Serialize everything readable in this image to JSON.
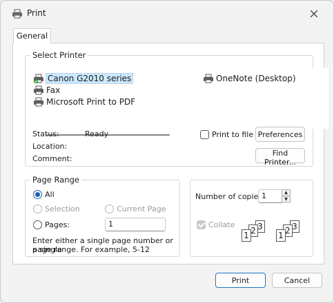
{
  "window": {
    "title": "Print",
    "icons": {
      "title": "printer-icon",
      "close": "close-icon"
    }
  },
  "tabs": [
    {
      "label": "General"
    }
  ],
  "select_printer": {
    "legend": "Select Printer",
    "printers": [
      {
        "label": "Canon G2010 series",
        "icon": "printer-default-icon",
        "selected": true
      },
      {
        "label": "Fax",
        "icon": "fax-icon"
      },
      {
        "label": "Microsoft Print to PDF",
        "icon": "printer-icon"
      },
      {
        "label": "OneNote (Desktop)",
        "icon": "printer-icon"
      }
    ],
    "status_label": "Status:",
    "status_value": "Ready",
    "location_label": "Location:",
    "comment_label": "Comment:",
    "print_to_file_label": "Print to file",
    "preferences_label": "Preferences",
    "find_printer_label": "Find Printer..."
  },
  "page_range": {
    "legend": "Page Range",
    "all_label": "All",
    "selection_label": "Selection",
    "current_page_label": "Current Page",
    "pages_label": "Pages:",
    "pages_value": "1",
    "help_line1": "Enter either a single page number or a single",
    "help_line2": "page range.  For example, 5-12"
  },
  "copies": {
    "number_label": "Number of copies:",
    "number_value": "1",
    "collate_label": "Collate",
    "collate_checked": true
  },
  "footer": {
    "print_label": "Print",
    "cancel_label": "Cancel"
  },
  "colors": {
    "accent": "#1a5fb4",
    "selection": "#cce8ff"
  }
}
